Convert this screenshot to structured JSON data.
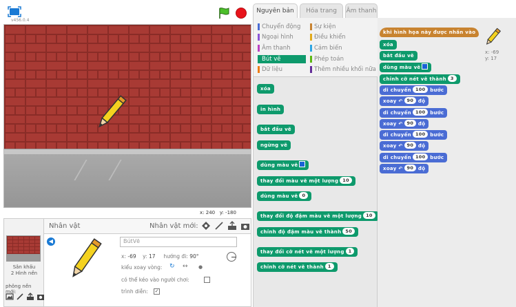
{
  "stage": {
    "version": "v456.0.4",
    "coords": {
      "x_label": "x:",
      "x_value": "240",
      "y_label": "y:",
      "y_value": "-180"
    }
  },
  "sprites_panel": {
    "title": "Nhân vật",
    "new_sprite_label": "Nhân vật mới:",
    "stage_label": "Sân khấu",
    "stage_backdrops": "2 Hình nền",
    "new_backdrop_label": "phông nền mới:",
    "sprite": {
      "name": "BútVẽ",
      "x_label": "x:",
      "x_value": "-69",
      "y_label": "y:",
      "y_value": "17",
      "direction_label": "hướng đi:",
      "direction_value": "90°",
      "rotation_label": "kiểu xoay vòng:",
      "draggable_label": "có thể kéo vào người chơi:",
      "show_label": "trình diễn:"
    }
  },
  "tabs": [
    {
      "label": "Nguyên bản",
      "active": true
    },
    {
      "label": "Hóa trang",
      "active": false
    },
    {
      "label": "Âm thanh",
      "active": false
    }
  ],
  "categories": {
    "left": [
      {
        "label": "Chuyển động",
        "color": "#4a6cd4"
      },
      {
        "label": "Ngoại hình",
        "color": "#8a55d7"
      },
      {
        "label": "Âm thanh",
        "color": "#bb42c3"
      },
      {
        "label": "Bút vẽ",
        "color": "#0e9a6c",
        "selected": true
      },
      {
        "label": "Dữ liệu",
        "color": "#ee7d16"
      }
    ],
    "right": [
      {
        "label": "Sự kiện",
        "color": "#c88330"
      },
      {
        "label": "Điều khiển",
        "color": "#e1a91a"
      },
      {
        "label": "Cảm biến",
        "color": "#2ca5e2"
      },
      {
        "label": "Phép toán",
        "color": "#5cb712"
      },
      {
        "label": "Thêm nhiều khối nữa",
        "color": "#632d99"
      }
    ]
  },
  "palette_blocks": {
    "clear": "xóa",
    "stamp": "in hình",
    "pen_down": "bắt đầu vẽ",
    "pen_up": "ngừng vẽ",
    "set_color_to": "dùng màu vẽ",
    "change_color_by": "thay đổi màu vẽ một lượng",
    "change_color_value": "10",
    "set_color_num": "dùng màu vẽ",
    "set_color_num_value": "0",
    "change_shade_by": "thay đổi độ đậm màu vẽ một lượng",
    "change_shade_value": "10",
    "set_shade_to": "chỉnh độ đậm màu vẽ thành",
    "set_shade_value": "50",
    "change_size_by": "thay đổi cỡ nét vẽ một lượng",
    "change_size_value": "1",
    "set_size_to": "chỉnh cỡ nét vẽ thành",
    "set_size_value": "1"
  },
  "script": {
    "hat": "khi hình họa này được nhấn vào",
    "clear": "xóa",
    "pen_down": "bắt đầu vẽ",
    "set_color": "dùng màu vẽ",
    "set_size": "chỉnh cỡ nét vẽ thành",
    "set_size_value": "3",
    "move": "di chuyển",
    "steps": "bước",
    "move_value": "100",
    "turn": "xoay",
    "degrees": "độ",
    "turn_value": "90",
    "sprite_x": "x: -69",
    "sprite_y": "y: 17"
  },
  "colors": {
    "pen_blocks": "#0e9a6c",
    "motion_blocks": "#4a6cd4",
    "event_blocks": "#c88330",
    "pen_color_swatch": "#1863d6",
    "stop_button": "#e8131b"
  }
}
